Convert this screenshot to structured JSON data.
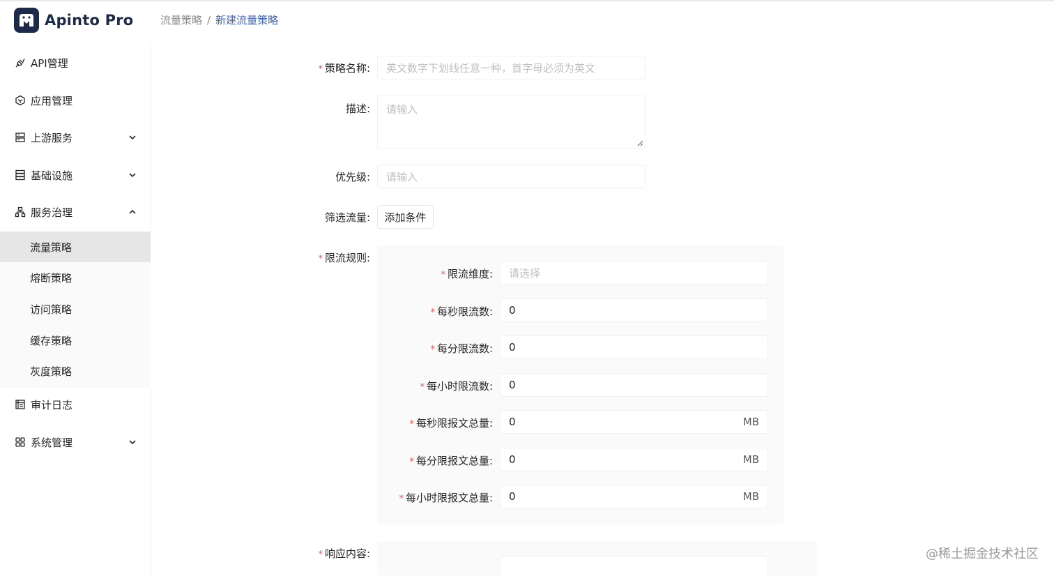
{
  "app": {
    "name": "Apinto Pro"
  },
  "breadcrumb": {
    "parent": "流量策略",
    "separator": "/",
    "current": "新建流量策略"
  },
  "sidebar": {
    "items": [
      {
        "label": "API管理",
        "icon": "api-icon"
      },
      {
        "label": "应用管理",
        "icon": "app-icon"
      },
      {
        "label": "上游服务",
        "icon": "upstream-icon",
        "expandable": true
      },
      {
        "label": "基础设施",
        "icon": "infrastructure-icon",
        "expandable": true
      },
      {
        "label": "服务治理",
        "icon": "governance-icon",
        "expandable": true,
        "expanded": true
      },
      {
        "label": "审计日志",
        "icon": "audit-log-icon"
      },
      {
        "label": "系统管理",
        "icon": "system-icon",
        "expandable": true
      }
    ],
    "governance_sub": [
      {
        "label": "流量策略",
        "active": true
      },
      {
        "label": "熔断策略"
      },
      {
        "label": "访问策略"
      },
      {
        "label": "缓存策略"
      },
      {
        "label": "灰度策略"
      }
    ]
  },
  "form": {
    "name": {
      "label": "策略名称:",
      "required": true,
      "placeholder": "英文数字下划线任意一种，首字母必须为英文"
    },
    "description": {
      "label": "描述:",
      "placeholder": "请输入"
    },
    "priority": {
      "label": "优先级:",
      "placeholder": "请输入"
    },
    "filter": {
      "label": "筛选流量:",
      "button": "添加条件"
    },
    "rules": {
      "label": "限流规则:",
      "required": true,
      "dimension": {
        "label": "限流维度:",
        "placeholder": "请选择"
      },
      "per_second": {
        "label": "每秒限流数:",
        "value": "0"
      },
      "per_minute": {
        "label": "每分限流数:",
        "value": "0"
      },
      "per_hour": {
        "label": "每小时限流数:",
        "value": "0"
      },
      "bytes_per_second": {
        "label": "每秒限报文总量:",
        "value": "0",
        "unit": "MB"
      },
      "bytes_per_minute": {
        "label": "每分限报文总量:",
        "value": "0",
        "unit": "MB"
      },
      "bytes_per_hour": {
        "label": "每小时限报文总量:",
        "value": "0",
        "unit": "MB"
      }
    },
    "response": {
      "label": "响应内容:",
      "required": true
    }
  },
  "watermark": "@稀土掘金技术社区",
  "colors": {
    "brand": "#1e2a4a",
    "link": "#3d63c4",
    "required": "#ff4d4f",
    "active_bg": "#e6e6e6"
  }
}
